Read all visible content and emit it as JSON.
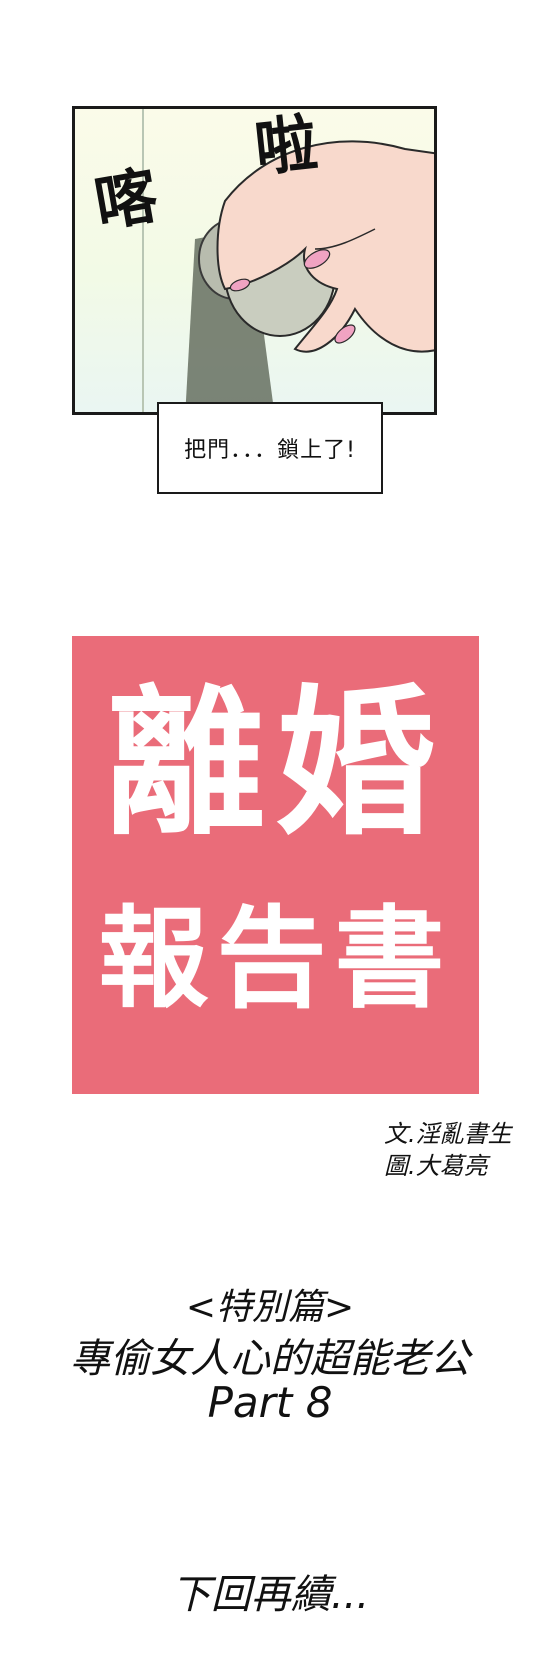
{
  "panel": {
    "sfx_left": "喀",
    "sfx_right": "啦",
    "caption": "把門．．．鎖上了!"
  },
  "title": {
    "line1": "離婚",
    "line2": "報告書",
    "background_color": "#ea6c79"
  },
  "credits": {
    "writer": "文.淫亂書生",
    "artist": "圖.大葛亮"
  },
  "chapter": {
    "tag": "<特別篇>",
    "name": "專偷女人心的超能老公",
    "part": "Part 8"
  },
  "footer": {
    "to_be_continued": "下回再續..."
  }
}
